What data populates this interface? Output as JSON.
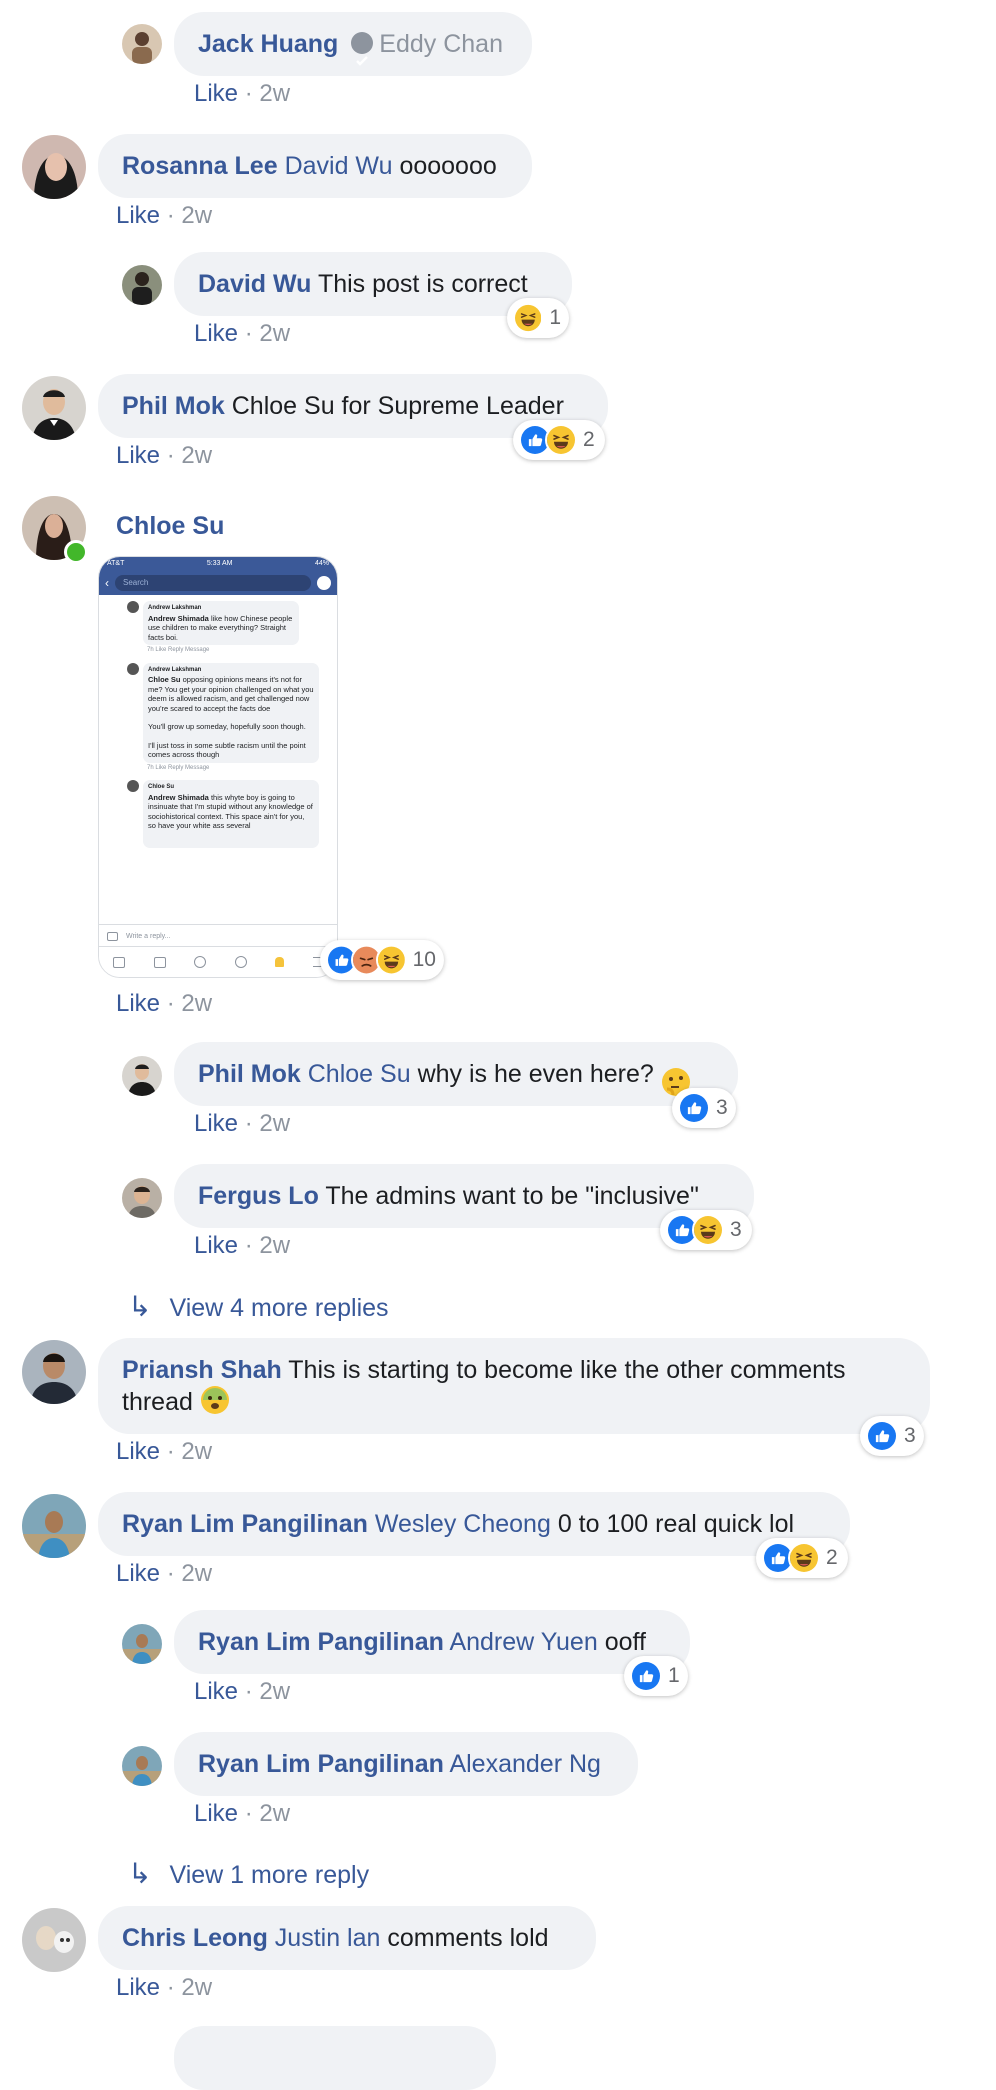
{
  "comments": [
    {
      "name": "Jack Huang",
      "mention": "Eddy Chan",
      "text": "",
      "meta": {
        "like": "Like",
        "time": "2w"
      }
    },
    {
      "name": "Rosanna Lee",
      "mention": "David Wu",
      "text": "ooooooo",
      "meta": {
        "like": "Like",
        "time": "2w"
      }
    },
    {
      "name": "David Wu",
      "mention": "",
      "text": "This post is correct",
      "meta": {
        "like": "Like",
        "time": "2w"
      },
      "reactions": {
        "count": "1"
      }
    },
    {
      "name": "Phil Mok",
      "mention": "",
      "text": "Chloe Su for Supreme Leader",
      "meta": {
        "like": "Like",
        "time": "2w"
      },
      "reactions": {
        "count": "2"
      }
    },
    {
      "name": "Chloe Su",
      "mention": "",
      "text": "",
      "meta": {
        "like": "Like",
        "time": "2w"
      },
      "reactions": {
        "count": "10"
      }
    },
    {
      "name": "Phil Mok",
      "mention": "Chloe Su",
      "text": "why is he even here?",
      "meta": {
        "like": "Like",
        "time": "2w"
      },
      "reactions": {
        "count": "3"
      }
    },
    {
      "name": "Fergus Lo",
      "mention": "",
      "text": "The admins want to be \"inclusive\"",
      "meta": {
        "like": "Like",
        "time": "2w"
      },
      "reactions": {
        "count": "3"
      }
    },
    {
      "name": "Priansh Shah",
      "mention": "",
      "text": "This is starting to become like the other comments thread",
      "meta": {
        "like": "Like",
        "time": "2w"
      },
      "reactions": {
        "count": "3"
      }
    },
    {
      "name": "Ryan Lim Pangilinan",
      "mention": "Wesley Cheong",
      "text": "0 to 100 real quick lol",
      "meta": {
        "like": "Like",
        "time": "2w"
      },
      "reactions": {
        "count": "2"
      }
    },
    {
      "name": "Ryan Lim Pangilinan",
      "mention": "Andrew Yuen",
      "text": "ooff",
      "meta": {
        "like": "Like",
        "time": "2w"
      },
      "reactions": {
        "count": "1"
      }
    },
    {
      "name": "Ryan Lim Pangilinan",
      "mention": "Alexander Ng",
      "text": "",
      "meta": {
        "like": "Like",
        "time": "2w"
      }
    },
    {
      "name": "Chris Leong",
      "mention": "Justin lan",
      "text": "comments lold",
      "meta": {
        "like": "Like",
        "time": "2w"
      }
    }
  ],
  "view_more": [
    {
      "label": "View 4 more replies"
    },
    {
      "label": "View 1 more reply"
    }
  ],
  "screenshot": {
    "status_carrier": "AT&T",
    "status_time": "5:33 AM",
    "status_battery": "44%",
    "search_placeholder": "Search",
    "items": [
      {
        "group": "Andrew Lakshman",
        "name": "Andrew Shimada",
        "text": "like how Chinese people use children to make everything? Straight facts boi.",
        "meta": "7h  Like  Reply  Message"
      },
      {
        "group": "Andrew Lakshman",
        "name": "Chloe Su",
        "text": "opposing opinions means it's not for me? You get your opinion challenged on what you deem is allowed racism, and get challenged now you're scared to accept the facts doe",
        "text2": "You'll grow up someday, hopefully soon though.",
        "text3": "I'll just toss in some subtle racism until the point comes across though",
        "meta": "7h  Like  Reply  Message"
      },
      {
        "group": "Chloe Su",
        "name": "Andrew Shimada",
        "text": "this whyte boy is going to insinuate that I'm stupid without any knowledge of sociohistorical context. This space ain't for you, so have your white ass several"
      }
    ],
    "reply_placeholder": "Write a reply..."
  },
  "colors": {
    "link": "#385898",
    "bubble": "#f0f2f5",
    "meta": "#8d949e",
    "like_blue": "#1877f2",
    "online": "#42b72a"
  }
}
